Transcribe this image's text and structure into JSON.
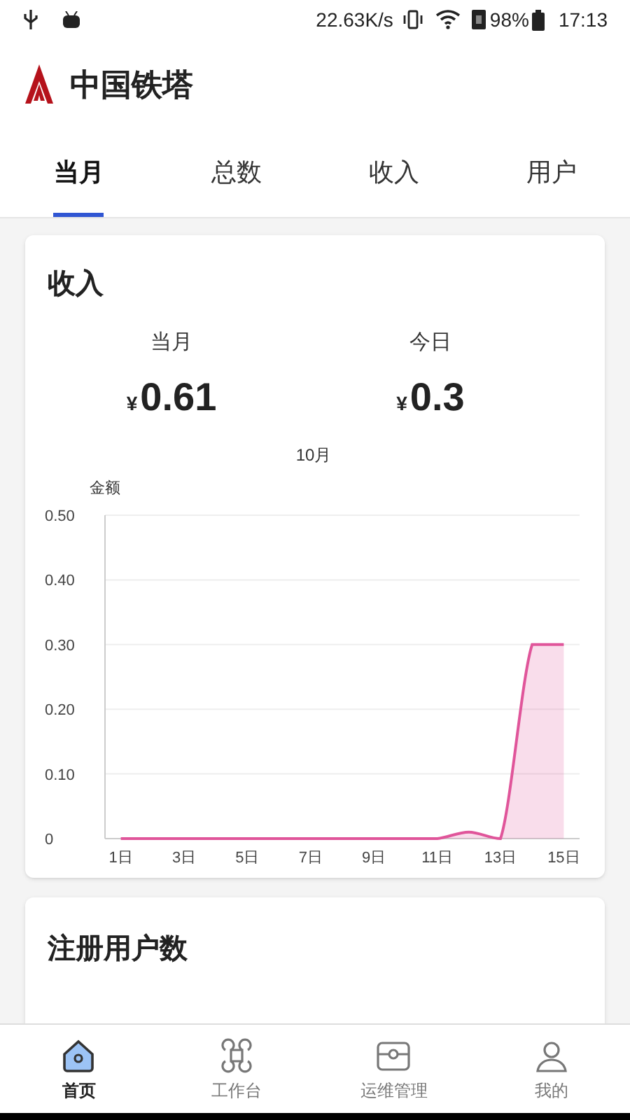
{
  "status_bar": {
    "speed": "22.63K/s",
    "battery": "98%",
    "time": "17:13"
  },
  "header": {
    "title": "中国铁塔"
  },
  "tabs": [
    {
      "label": "当月",
      "selected": true
    },
    {
      "label": "总数",
      "selected": false
    },
    {
      "label": "收入",
      "selected": false
    },
    {
      "label": "用户",
      "selected": false
    }
  ],
  "income_card": {
    "title": "收入",
    "stats": [
      {
        "label": "当月",
        "currency": "¥",
        "value": "0.61"
      },
      {
        "label": "今日",
        "currency": "¥",
        "value": "0.3"
      }
    ],
    "chart_data": {
      "type": "area",
      "title": "10月",
      "ylabel": "金额",
      "x": [
        1,
        2,
        3,
        4,
        5,
        6,
        7,
        8,
        9,
        10,
        11,
        12,
        13,
        14,
        15
      ],
      "series": [
        {
          "color": "#e0559a",
          "values": [
            0,
            0,
            0,
            0,
            0,
            0,
            0,
            0,
            0,
            0,
            0,
            0.01,
            0,
            0.3,
            0.3
          ]
        }
      ],
      "xlim": [
        0.5,
        15.5
      ],
      "ylim": [
        0,
        0.5
      ],
      "grid": true,
      "yticks": [
        {
          "value": 0,
          "label": "0"
        },
        {
          "value": 0.1,
          "label": "0.10"
        },
        {
          "value": 0.2,
          "label": "0.20"
        },
        {
          "value": 0.3,
          "label": "0.30"
        },
        {
          "value": 0.4,
          "label": "0.40"
        },
        {
          "value": 0.5,
          "label": "0.50"
        }
      ],
      "xticks": [
        {
          "value": 1,
          "label": "1日"
        },
        {
          "value": 3,
          "label": "3日"
        },
        {
          "value": 5,
          "label": "5日"
        },
        {
          "value": 7,
          "label": "7日"
        },
        {
          "value": 9,
          "label": "9日"
        },
        {
          "value": 11,
          "label": "11日"
        },
        {
          "value": 13,
          "label": "13日"
        },
        {
          "value": 15,
          "label": "15日"
        }
      ]
    }
  },
  "users_card": {
    "title": "注册用户数"
  },
  "bottom_nav": [
    {
      "kind": "home",
      "label": "首页",
      "selected": true
    },
    {
      "kind": "workbench",
      "label": "工作台",
      "selected": false
    },
    {
      "kind": "maintenance",
      "label": "运维管理",
      "selected": false
    },
    {
      "kind": "profile",
      "label": "我的",
      "selected": false
    }
  ]
}
